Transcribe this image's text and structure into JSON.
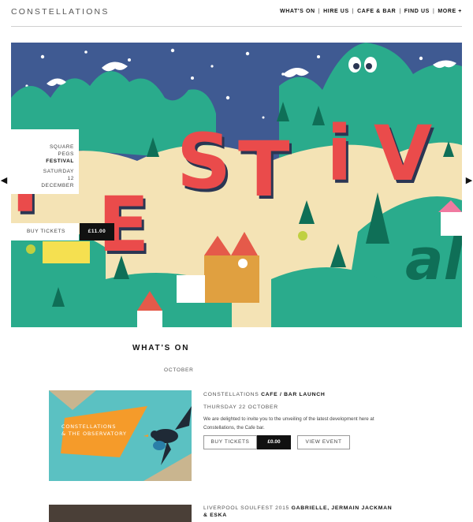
{
  "header": {
    "logo": "CONSTELLATIONS",
    "nav": [
      {
        "label": "WHAT'S ON"
      },
      {
        "label": "HIRE US"
      },
      {
        "label": "CAFE & BAR"
      },
      {
        "label": "FIND US"
      },
      {
        "label": "MORE +"
      }
    ]
  },
  "hero": {
    "line1": "SQUARE",
    "line2": "PEGS",
    "line3": "FESTIVAL",
    "line4": "SATURDAY",
    "line5": "12",
    "line6": "DECEMBER",
    "buy_label": "BUY TICKETS",
    "price": "£11.00",
    "art_word_1": "FESTiVAL",
    "art_word_2": "al",
    "prev_arrow": "◀",
    "next_arrow": "▶"
  },
  "whats_on": {
    "title": "WHAT'S ON",
    "month": "OCTOBER"
  },
  "events": [
    {
      "title_prefix": "CONSTELLATIONS",
      "title_strong": "CAFE / BAR LAUNCH",
      "date": "THURSDAY 22 OCTOBER",
      "description": "We are delighted to invite you to the unveiling of the latest development here at Constellations, the Cafe bar.",
      "buy_label": "BUY TICKETS",
      "price": "£0.00",
      "view_label": "VIEW EVENT",
      "image_text_1": "CONSTELLATIONS",
      "image_text_2": "& THE OBSERVATORY"
    },
    {
      "title_prefix": "LIVERPOOL SOULFEST 2015",
      "title_strong": "GABRIELLE, JERMAIN JACKMAN & ESKA"
    }
  ],
  "colors": {
    "sky": "#3f5a92",
    "mountain": "#2aab8c",
    "sand": "#f4e3b5",
    "letter": "#ea4b4b",
    "letter_shadow": "#2b3653",
    "dark_hill": "#0f6f57",
    "event_bg": "#4fc2c8",
    "event_accent": "#f59b2a"
  }
}
